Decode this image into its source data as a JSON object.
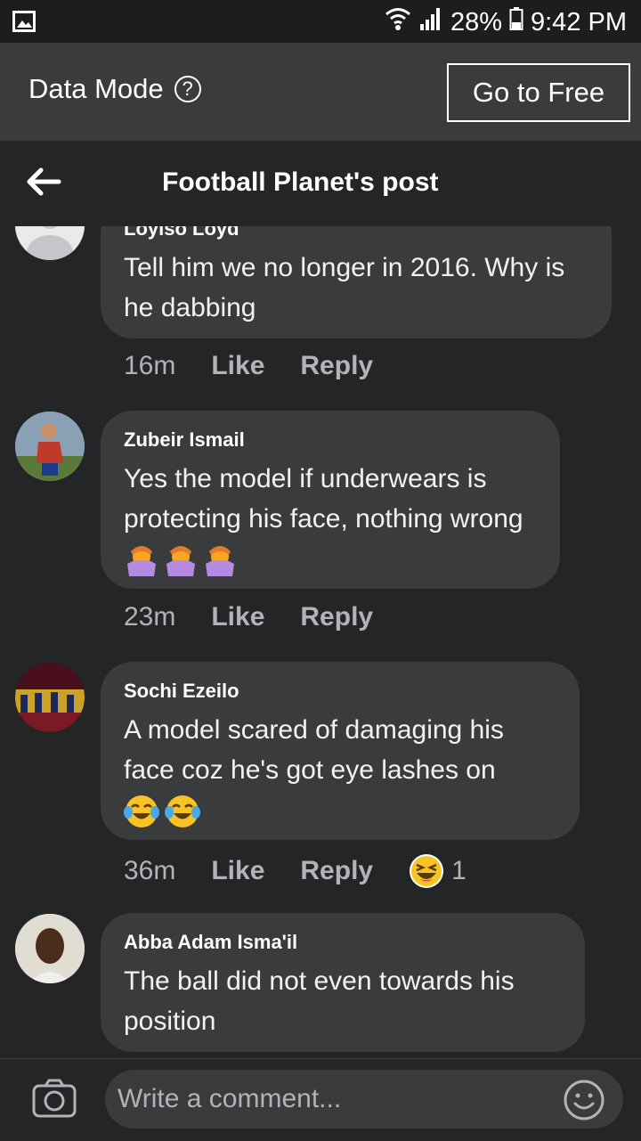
{
  "status_bar": {
    "battery": "28%",
    "time": "9:42 PM",
    "icons": [
      "image-icon",
      "wifi-icon",
      "signal-icon",
      "battery-icon"
    ]
  },
  "data_mode": {
    "label": "Data Mode",
    "help_icon": "?",
    "go_to_free": "Go to Free"
  },
  "header": {
    "title": "Football Planet's post"
  },
  "comments": [
    {
      "author": "Loyiso Loyd",
      "text": "Tell him we no longer in 2016. Why is he dabbing",
      "time": "16m",
      "like": "Like",
      "reply": "Reply"
    },
    {
      "author": "Zubeir Ismail",
      "text": "Yes the model if underwears is protecting his face, nothing wrong",
      "time": "23m",
      "like": "Like",
      "reply": "Reply"
    },
    {
      "author": "Sochi Ezeilo",
      "text": "A model scared of damaging his face coz he's got eye lashes on",
      "time": "36m",
      "like": "Like",
      "reply": "Reply",
      "reaction_count": "1"
    },
    {
      "author": "Abba Adam Isma'il",
      "text": "The ball did not even towards his position"
    }
  ],
  "footer": {
    "placeholder": "Write a comment..."
  },
  "colors": {
    "background": "#242527",
    "bubble": "#3a3b3d",
    "status_bar": "#1c1d1f",
    "data_bar": "#3a3b3d"
  }
}
